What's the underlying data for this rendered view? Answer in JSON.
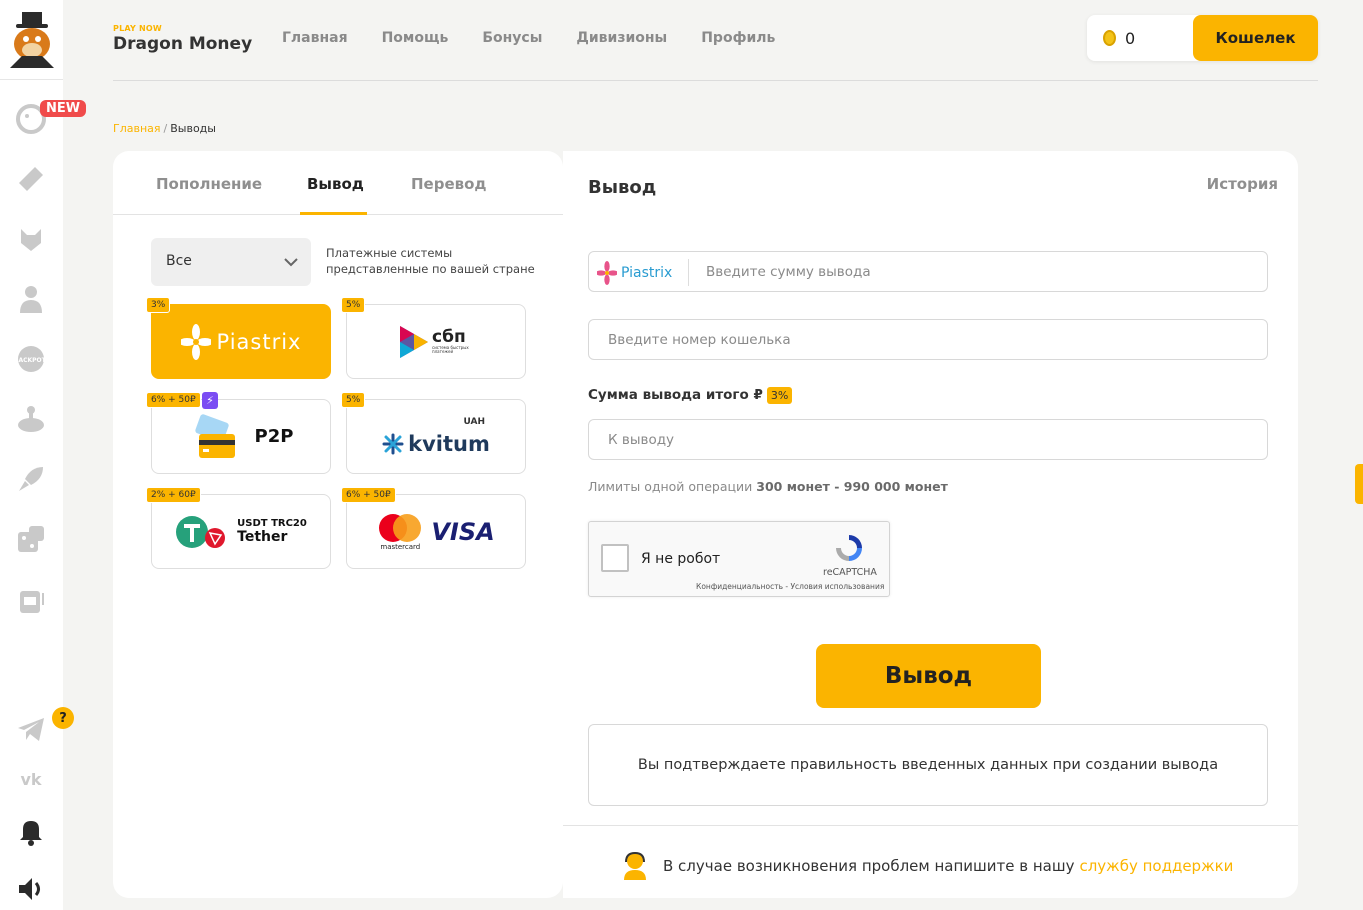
{
  "header": {
    "brand_tagline": "PLAY NOW",
    "brand_name": "Dragon Money",
    "nav": [
      "Главная",
      "Помощь",
      "Бонусы",
      "Дивизионы",
      "Профиль"
    ],
    "balance": "0",
    "wallet_label": "Кошелек"
  },
  "sidebar": {
    "new_badge": "NEW",
    "help_badge": "?"
  },
  "breadcrumb": {
    "home": "Главная",
    "separator": "/",
    "current": "Выводы"
  },
  "tabs": [
    "Пополнение",
    "Вывод",
    "Перевод"
  ],
  "filter": {
    "selected": "Все",
    "note": "Платежные системы представленные по вашей стране"
  },
  "methods": [
    {
      "name": "Piastrix",
      "fee": "3%",
      "active": true
    },
    {
      "name": "сбп",
      "sub": "система быстрых платежей",
      "fee": "5%"
    },
    {
      "name": "P2P",
      "fee": "6% + 50₽",
      "bolt": "⚡"
    },
    {
      "name": "kvitum",
      "currency": "UAH",
      "fee": "5%"
    },
    {
      "name": "Tether",
      "sub": "USDT TRC20",
      "fee": "2% + 60₽"
    },
    {
      "name": "VISA",
      "sub": "mastercard",
      "fee": "6% + 50₽"
    }
  ],
  "withdraw": {
    "title": "Вывод",
    "history": "История",
    "method_label": "Piastrix",
    "amount_placeholder": "Введите сумму вывода",
    "wallet_placeholder": "Введите номер кошелька",
    "total_label": "Сумма вывода итого ₽",
    "total_fee": "3%",
    "result_placeholder": "К выводу",
    "limits_prefix": "Лимиты одной операции",
    "limits_value": "300 монет - 990 000 монет",
    "captcha_label": "Я не робот",
    "captcha_brand": "reCAPTCHA",
    "captcha_links": "Конфиденциальность - Условия использования",
    "submit": "Вывод",
    "confirm_text": "Вы подтверждаете правильность введенных данных при создании вывода",
    "support_text": "В случае возникновения проблем напишите в нашу",
    "support_link": "службу поддержки"
  },
  "colors": {
    "accent": "#fbb400",
    "link_blue": "#2a9cd1",
    "badge_red": "#f04b4b"
  }
}
